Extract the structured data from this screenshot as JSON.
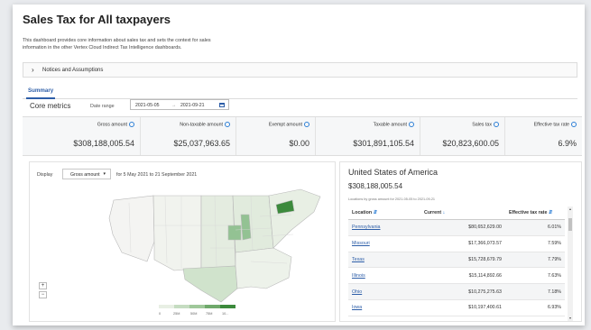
{
  "header": {
    "title": "Sales Tax for All taxpayers",
    "intro_line1": "This dashboard provides core information about sales tax and sets the context for sales",
    "intro_line2": "information in the other Vertex Cloud Indirect Tax Intelligence dashboards."
  },
  "notices": {
    "label": "Notices and Assumptions"
  },
  "tabs": [
    {
      "label": "Summary",
      "active": true
    }
  ],
  "core": {
    "title": "Core metrics",
    "date_range_label": "Date range",
    "date_from": "2021-05-05",
    "date_sep": "→",
    "date_to": "2021-09-21"
  },
  "metrics": [
    {
      "label": "Gross amount",
      "value": "$308,188,005.54"
    },
    {
      "label": "Non-taxable amount",
      "value": "$25,037,963.65"
    },
    {
      "label": "Exempt amount",
      "value": "$0.00"
    },
    {
      "label": "Taxable amount",
      "value": "$301,891,105.54"
    },
    {
      "label": "Sales tax",
      "value": "$20,823,600.05"
    },
    {
      "label": "Effective tax rate",
      "value": "6.9%"
    }
  ],
  "map": {
    "display_label": "Display",
    "display_value": "Gross amount",
    "period_text": "for 5 May 2021 to 21 September 2021",
    "zoom_in": "+",
    "zoom_out": "−",
    "legend_ticks": [
      "0",
      "25M",
      "50M",
      "75M",
      "10..."
    ],
    "colors": {
      "high": "#3c8a3c",
      "mid": "#93c293",
      "low": "#e4ece0",
      "base": "#f4f4f2",
      "border": "#b9b9b9"
    }
  },
  "usa": {
    "title": "United States of America",
    "total": "$308,188,005.54",
    "note": "Locations by gross amount for 2021-05-05 to 2021-09-21",
    "col_location": "Location",
    "col_current": "Current",
    "col_rate": "Effective tax rate",
    "rows": [
      {
        "location": "Pennsylvania",
        "current": "$80,652,629.00",
        "rate": "6.01%"
      },
      {
        "location": "Missouri",
        "current": "$17,366,073.57",
        "rate": "7.59%"
      },
      {
        "location": "Texas",
        "current": "$15,728,679.79",
        "rate": "7.79%"
      },
      {
        "location": "Illinois",
        "current": "$15,114,892.66",
        "rate": "7.63%"
      },
      {
        "location": "Ohio",
        "current": "$10,275,275.63",
        "rate": "7.18%"
      },
      {
        "location": "Iowa",
        "current": "$10,197,400.61",
        "rate": "6.93%"
      }
    ]
  },
  "accent": "#2d5ea8"
}
